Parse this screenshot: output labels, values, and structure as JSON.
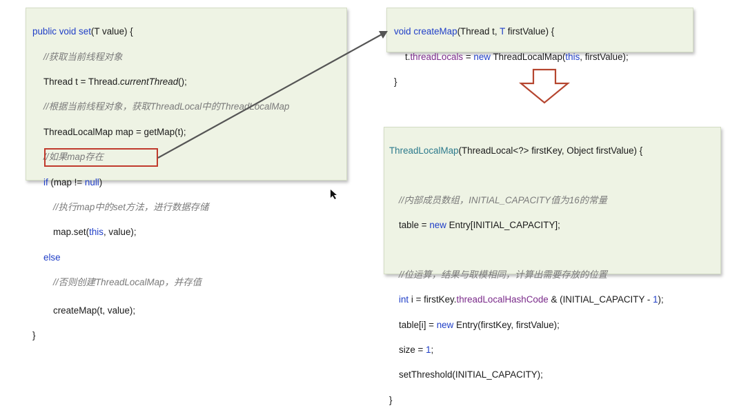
{
  "set_method": {
    "sig_public": "public",
    "sig_void": "void",
    "sig_name": "set",
    "sig_params": "(T value) {",
    "c1": "//获取当前线程对象",
    "l2_a": "Thread t = Thread.",
    "l2_b": "currentThread",
    "l2_c": "();",
    "c2": "//根据当前线程对象，获取ThreadLocal中的ThreadLocalMap",
    "l3": "ThreadLocalMap map = getMap(t);",
    "c3": "//如果map存在",
    "l4_if": "if",
    "l4_a": " (map != ",
    "l4_null": "null",
    "l4_b": ")",
    "c4": "//执行map中的set方法，进行数据存储",
    "l5_a": "map.set(",
    "l5_this": "this",
    "l5_b": ", value);",
    "l6_else": "else",
    "c5": "//否则创建ThreadLocalMap，并存值",
    "l7": "createMap(t, value);",
    "close": "}"
  },
  "create_map": {
    "sig_void": "void",
    "sig_name": "createMap",
    "sig_a": "(Thread t, ",
    "sig_T": "T",
    "sig_b": " firstValue) {",
    "l1_a": "t.",
    "l1_field": "threadLocals",
    "l1_b": " = ",
    "l1_new": "new",
    "l1_c": " ThreadLocalMap(",
    "l1_this": "this",
    "l1_d": ", firstValue);",
    "close": "}"
  },
  "constructor": {
    "sig_name": "ThreadLocalMap",
    "sig_rest": "(ThreadLocal<?> firstKey, Object firstValue) {",
    "c1": "//内部成员数组，INITIAL_CAPACITY值为16的常量",
    "l1_a": "table = ",
    "l1_new": "new",
    "l1_b": " Entry[INITIAL_CAPACITY];",
    "c2": "//位运算，结果与取模相同，计算出需要存放的位置",
    "l2_int": "int",
    "l2_a": " i = firstKey.",
    "l2_field": "threadLocalHashCode",
    "l2_b": " & (INITIAL_CAPACITY - ",
    "l2_one": "1",
    "l2_c": ");",
    "l3_a": "table[i] = ",
    "l3_new": "new",
    "l3_b": " Entry(firstKey, firstValue);",
    "l4_a": "size = ",
    "l4_one": "1",
    "l4_b": ";",
    "l5": "setThreshold(INITIAL_CAPACITY);",
    "close": "}"
  },
  "colors": {
    "panel_bg": "#eef3e4",
    "keyword": "#1f3ec7",
    "comment": "#7a7a7a",
    "highlight": "#c0392b",
    "arrow": "#555555",
    "down_arrow": "#b5452f"
  },
  "icons": [
    "arrow-connector-icon",
    "down-arrow-icon",
    "mouse-cursor-icon"
  ]
}
